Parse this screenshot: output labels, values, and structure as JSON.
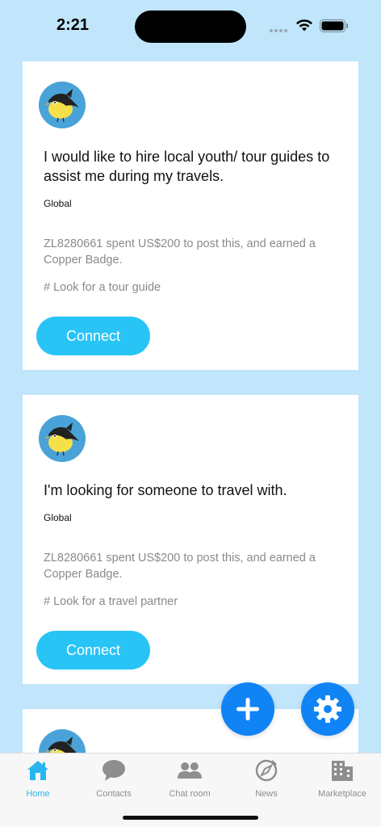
{
  "status_bar": {
    "time": "2:21"
  },
  "posts": [
    {
      "title": "I would like to hire local youth/ tour guides to assist me during my travels.",
      "region": "Global",
      "meta": "ZL8280661 spent US$200 to post this, and earned a Copper Badge.",
      "tag": "# Look for a tour guide",
      "button": "Connect"
    },
    {
      "title": "I'm looking for someone to travel with.",
      "region": "Global",
      "meta": "ZL8280661 spent US$200 to post this, and earned a Copper Badge.",
      "tag": "# Look for a travel partner",
      "button": "Connect"
    }
  ],
  "fabs": {
    "add": "plus-icon",
    "settings": "gear-icon"
  },
  "tabs": [
    {
      "label": "Home",
      "icon": "home-icon",
      "active": true
    },
    {
      "label": "Contacts",
      "icon": "chat-bubble-icon",
      "active": false
    },
    {
      "label": "Chat room",
      "icon": "people-icon",
      "active": false
    },
    {
      "label": "News",
      "icon": "compass-icon",
      "active": false
    },
    {
      "label": "Marketplace",
      "icon": "building-icon",
      "active": false
    }
  ],
  "colors": {
    "background": "#c1e5fb",
    "accent": "#29c4f6",
    "fab": "#1184f5",
    "active_tab": "#29b6f0"
  }
}
